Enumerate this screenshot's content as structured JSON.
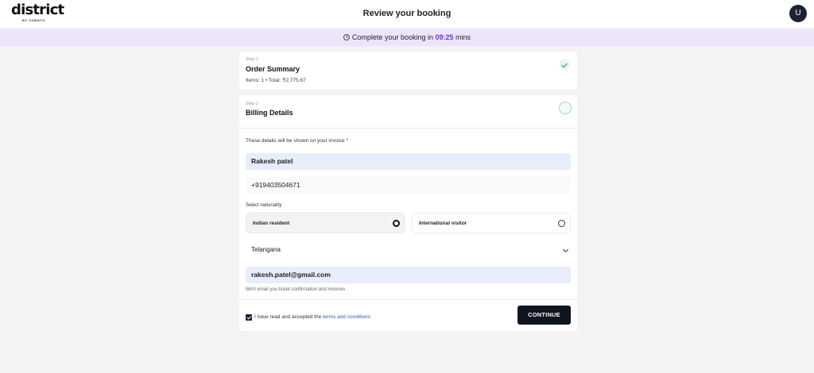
{
  "header": {
    "logo_main": "district",
    "logo_sub": "BY ZOMATO",
    "title": "Review your booking",
    "avatar_initial": "U"
  },
  "timer": {
    "prefix": "Complete your booking in",
    "value": "09:25",
    "suffix": "mins"
  },
  "step1": {
    "label": "Step 1",
    "title": "Order Summary",
    "summary": "Items: 1 • Total: ₹2,775.67",
    "status_icon": "check-icon"
  },
  "step2": {
    "label": "Step 2",
    "title": "Billing Details",
    "status_icon": "ring-icon"
  },
  "billing": {
    "invoice_note": "These details will be shown on your invoice *",
    "name_value": "Rakesh patel",
    "phone_value": "+919403504671",
    "nationality_label": "Select nationality",
    "nationality_options": [
      "Indian resident",
      "International visitor"
    ],
    "nationality_selected": "Indian resident",
    "state_value": "Telangana",
    "email_value": "rakesh.patel@gmail.com",
    "email_hint": "We'll email you ticket confirmation and invoices"
  },
  "terms": {
    "checked": true,
    "text": "I have read and accepted the",
    "link": "terms and conditions"
  },
  "actions": {
    "continue_label": "CONTINUE"
  },
  "colors": {
    "timer_accent": "#6b35c4",
    "timer_bg": "#ede5fb",
    "field_fill": "#e7edfa",
    "button_bg": "#0f1421",
    "check_green": "#2f9e5b",
    "link": "#3654b8"
  }
}
